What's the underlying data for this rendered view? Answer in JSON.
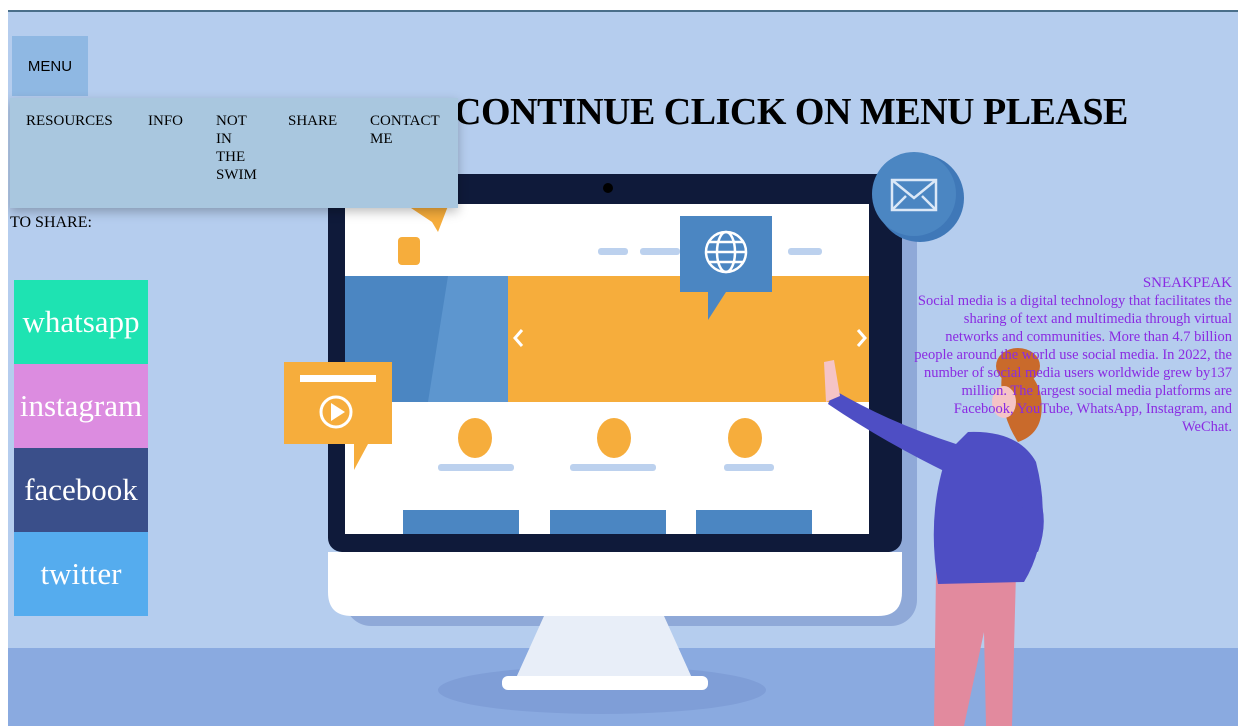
{
  "menu": {
    "button_label": "MENU"
  },
  "nav": {
    "resources": "RESOURCES",
    "info": "INFO",
    "not_in_the_swim": [
      "NOT",
      "IN",
      "THE",
      "SWIM"
    ],
    "share": "SHARE",
    "contact": [
      "CONTACT",
      "ME"
    ]
  },
  "page": {
    "title": "CONTINUE CLICK ON MENU PLEASE",
    "share_label": "TO SHARE:"
  },
  "social_buttons": [
    {
      "label": "whatsapp",
      "color": "#1ee3b2"
    },
    {
      "label": "instagram",
      "color": "#dc8ce0"
    },
    {
      "label": "facebook",
      "color": "#3a4f8a"
    },
    {
      "label": "twitter",
      "color": "#55acee"
    }
  ],
  "sneakpeak": {
    "title": "SNEAKPEAK",
    "text": "Social media is a digital technology that facilitates the sharing of text and multimedia through virtual networks and communities. More than 4.7 billion people around the world use social media. In 2022, the number of social media users worldwide grew by137 million. The largest social media platforms are Facebook, YouTube, WhatsApp, Instagram, and WeChat."
  },
  "illustration": {
    "icons": [
      "globe-icon",
      "envelope-icon",
      "play-icon",
      "chevron-left-icon",
      "chevron-right-icon"
    ],
    "colors": {
      "background": "#b5cdee",
      "monitor": "#0f1a3a",
      "orange": "#f6ad3c",
      "blue_panel": "#4b86c2",
      "purple_text": "#8a2be2"
    }
  }
}
